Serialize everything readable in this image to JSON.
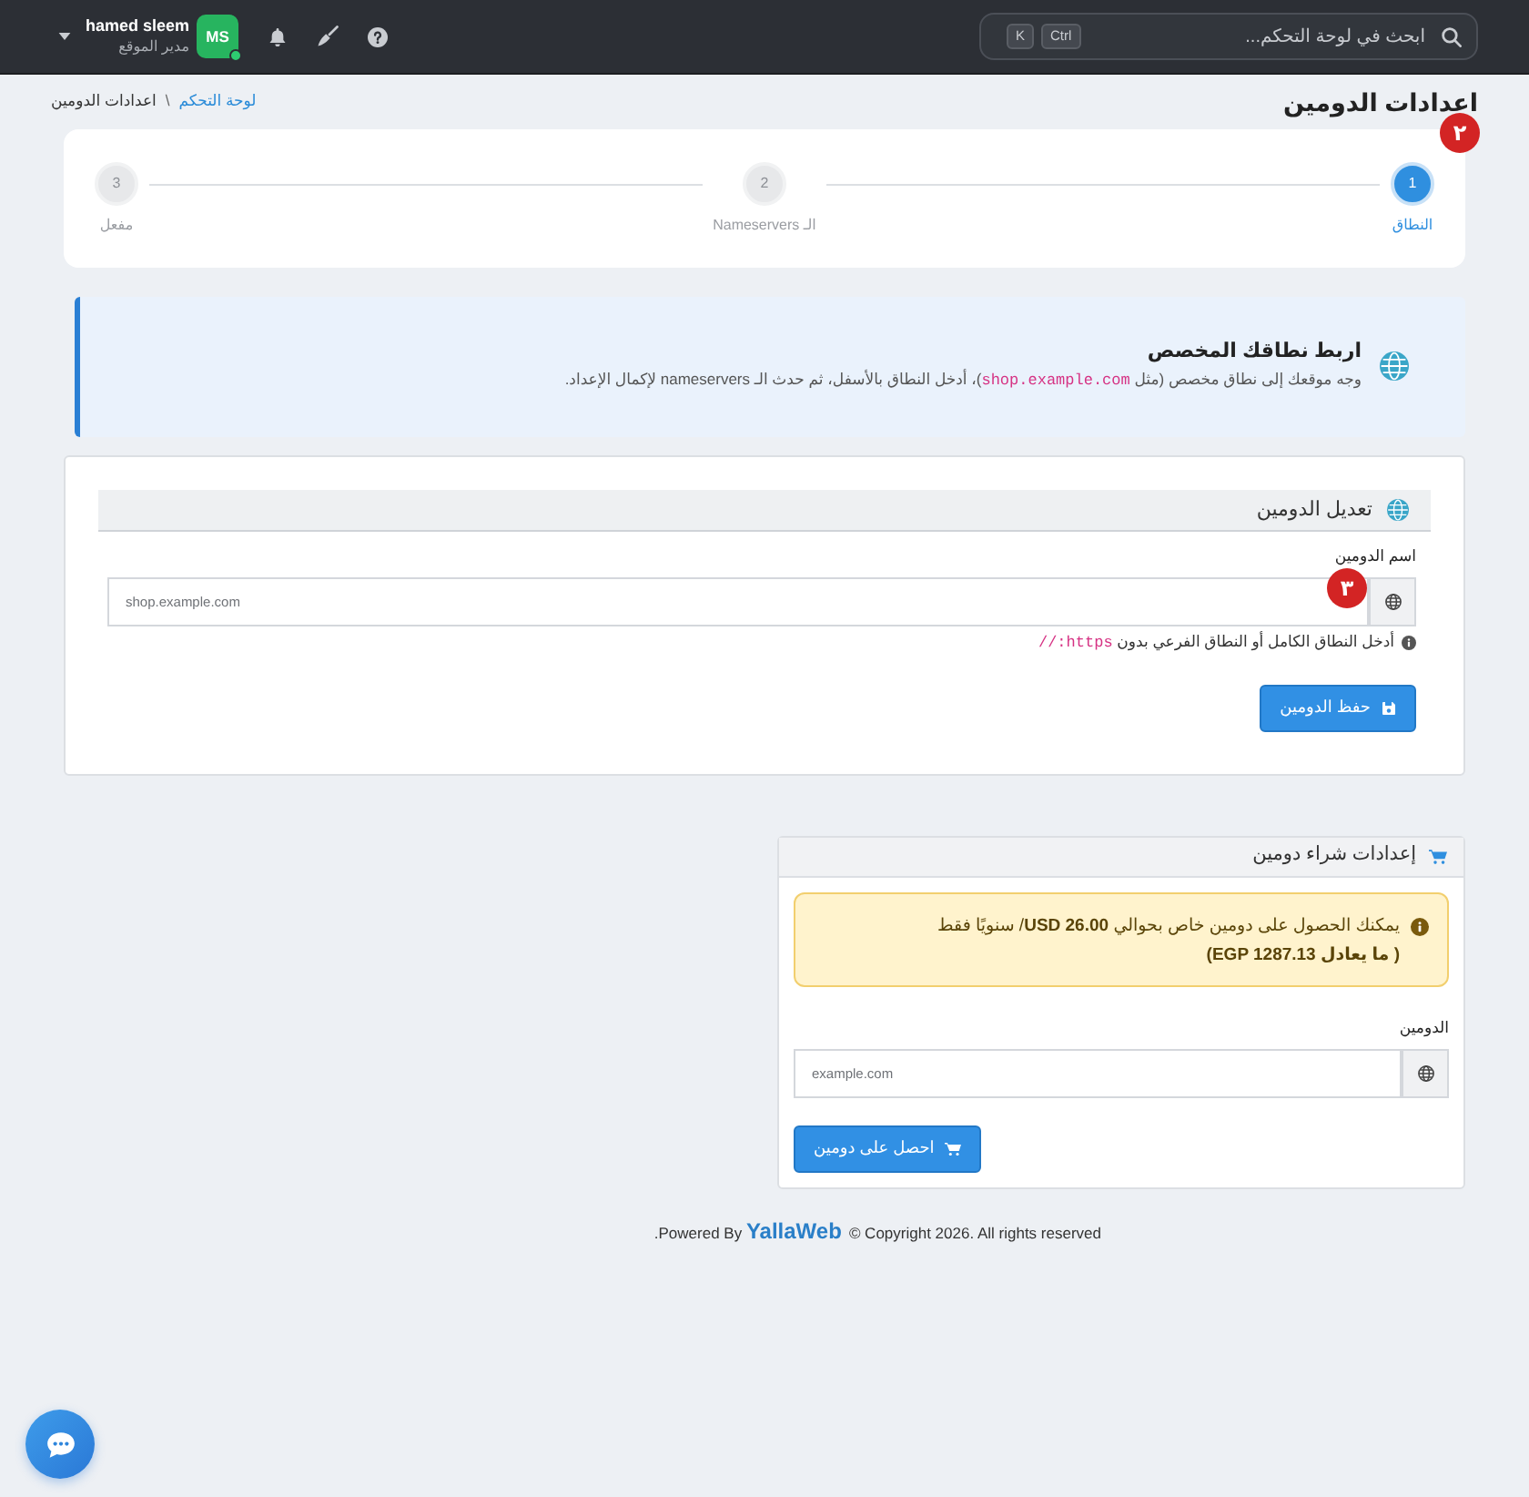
{
  "topbar": {
    "search": {
      "placeholder": "ابحث في لوحة التحكم...",
      "shortcut": [
        "Ctrl",
        "K"
      ]
    },
    "user": {
      "initials": "MS",
      "online": true,
      "name": "hamed sleem",
      "role": "مدير الموقع"
    }
  },
  "page_header": {
    "title": "اعدادات الدومين",
    "breadcrumb": [
      {
        "kind": "link",
        "label": "لوحة التحكم"
      },
      {
        "kind": "separator",
        "label": "\\"
      },
      {
        "kind": "current",
        "label": "اعدادات الدومين"
      }
    ]
  },
  "stepper": {
    "annotation": "٢",
    "steps": [
      {
        "number": "1",
        "label": "النطاق",
        "selected": true
      },
      {
        "number": "2",
        "label": "الـ Nameservers",
        "selected": false
      },
      {
        "number": "3",
        "label": "مفعل",
        "selected": false
      }
    ]
  },
  "intro_panel": {
    "title": "اربط نطاقك المخصص",
    "text": [
      {
        "kind": "text",
        "value": "وجه موقعك إلى نطاق مخصص (مثل "
      },
      {
        "kind": "code",
        "value": "shop.example.com"
      },
      {
        "kind": "text",
        "value": ")، أدخل النطاق بالأسفل، ثم حدث الـ nameservers لإكمال الإعداد."
      }
    ]
  },
  "domain_edit": {
    "title": "تعديل الدومين",
    "field": {
      "label": "اسم الدومين",
      "placeholder": "shop.example.com",
      "annotation": "٣"
    },
    "hint": [
      {
        "kind": "text",
        "value": "أدخل النطاق الكامل أو النطاق الفرعي بدون "
      },
      {
        "kind": "code",
        "value": "https://"
      }
    ],
    "button": "حفظ الدومين"
  },
  "domain_purchase": {
    "title": "إعدادات شراء دومين",
    "notice": {
      "text": "يمكنك الحصول على دومين خاص بحوالي **USD 26.00**/ سنويًا فقط",
      "note": "( ما يعادل EGP 1287.13)"
    },
    "field": {
      "label": "الدومين",
      "placeholder": "example.com"
    },
    "button": "احصل على دومين"
  },
  "footer": {
    "copyright": "© Copyright 2026. All rights reserved",
    "credit": {
      "before": "Powered By",
      "brand": "YallaWeb",
      "after": "."
    }
  }
}
